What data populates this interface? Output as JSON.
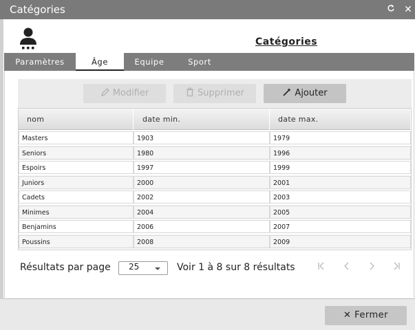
{
  "window": {
    "title": "Catégories",
    "refresh_icon": "refresh-icon",
    "close_icon": "close-icon"
  },
  "header": {
    "avatar_icon": "user-icon",
    "title": "Catégories"
  },
  "tabs": [
    {
      "label": "Paramètres",
      "active": false
    },
    {
      "label": "Âge",
      "active": true
    },
    {
      "label": "Equipe",
      "active": false
    },
    {
      "label": "Sport",
      "active": false
    }
  ],
  "toolbar": {
    "modify_label": "Modifier",
    "delete_label": "Supprimer",
    "add_label": "Ajouter"
  },
  "table": {
    "columns": [
      "nom",
      "date min.",
      "date max."
    ],
    "rows": [
      [
        "Masters",
        "1903",
        "1979"
      ],
      [
        "Seniors",
        "1980",
        "1996"
      ],
      [
        "Espoirs",
        "1997",
        "1999"
      ],
      [
        "Juniors",
        "2000",
        "2001"
      ],
      [
        "Cadets",
        "2002",
        "2003"
      ],
      [
        "Minimes",
        "2004",
        "2005"
      ],
      [
        "Benjamins",
        "2006",
        "2007"
      ],
      [
        "Poussins",
        "2008",
        "2009"
      ]
    ]
  },
  "pagination": {
    "per_page_label": "Résultats par page",
    "per_page_value": "25",
    "summary": "Voir 1 à 8 sur 8 résultats"
  },
  "footer": {
    "close_label": "Fermer"
  }
}
